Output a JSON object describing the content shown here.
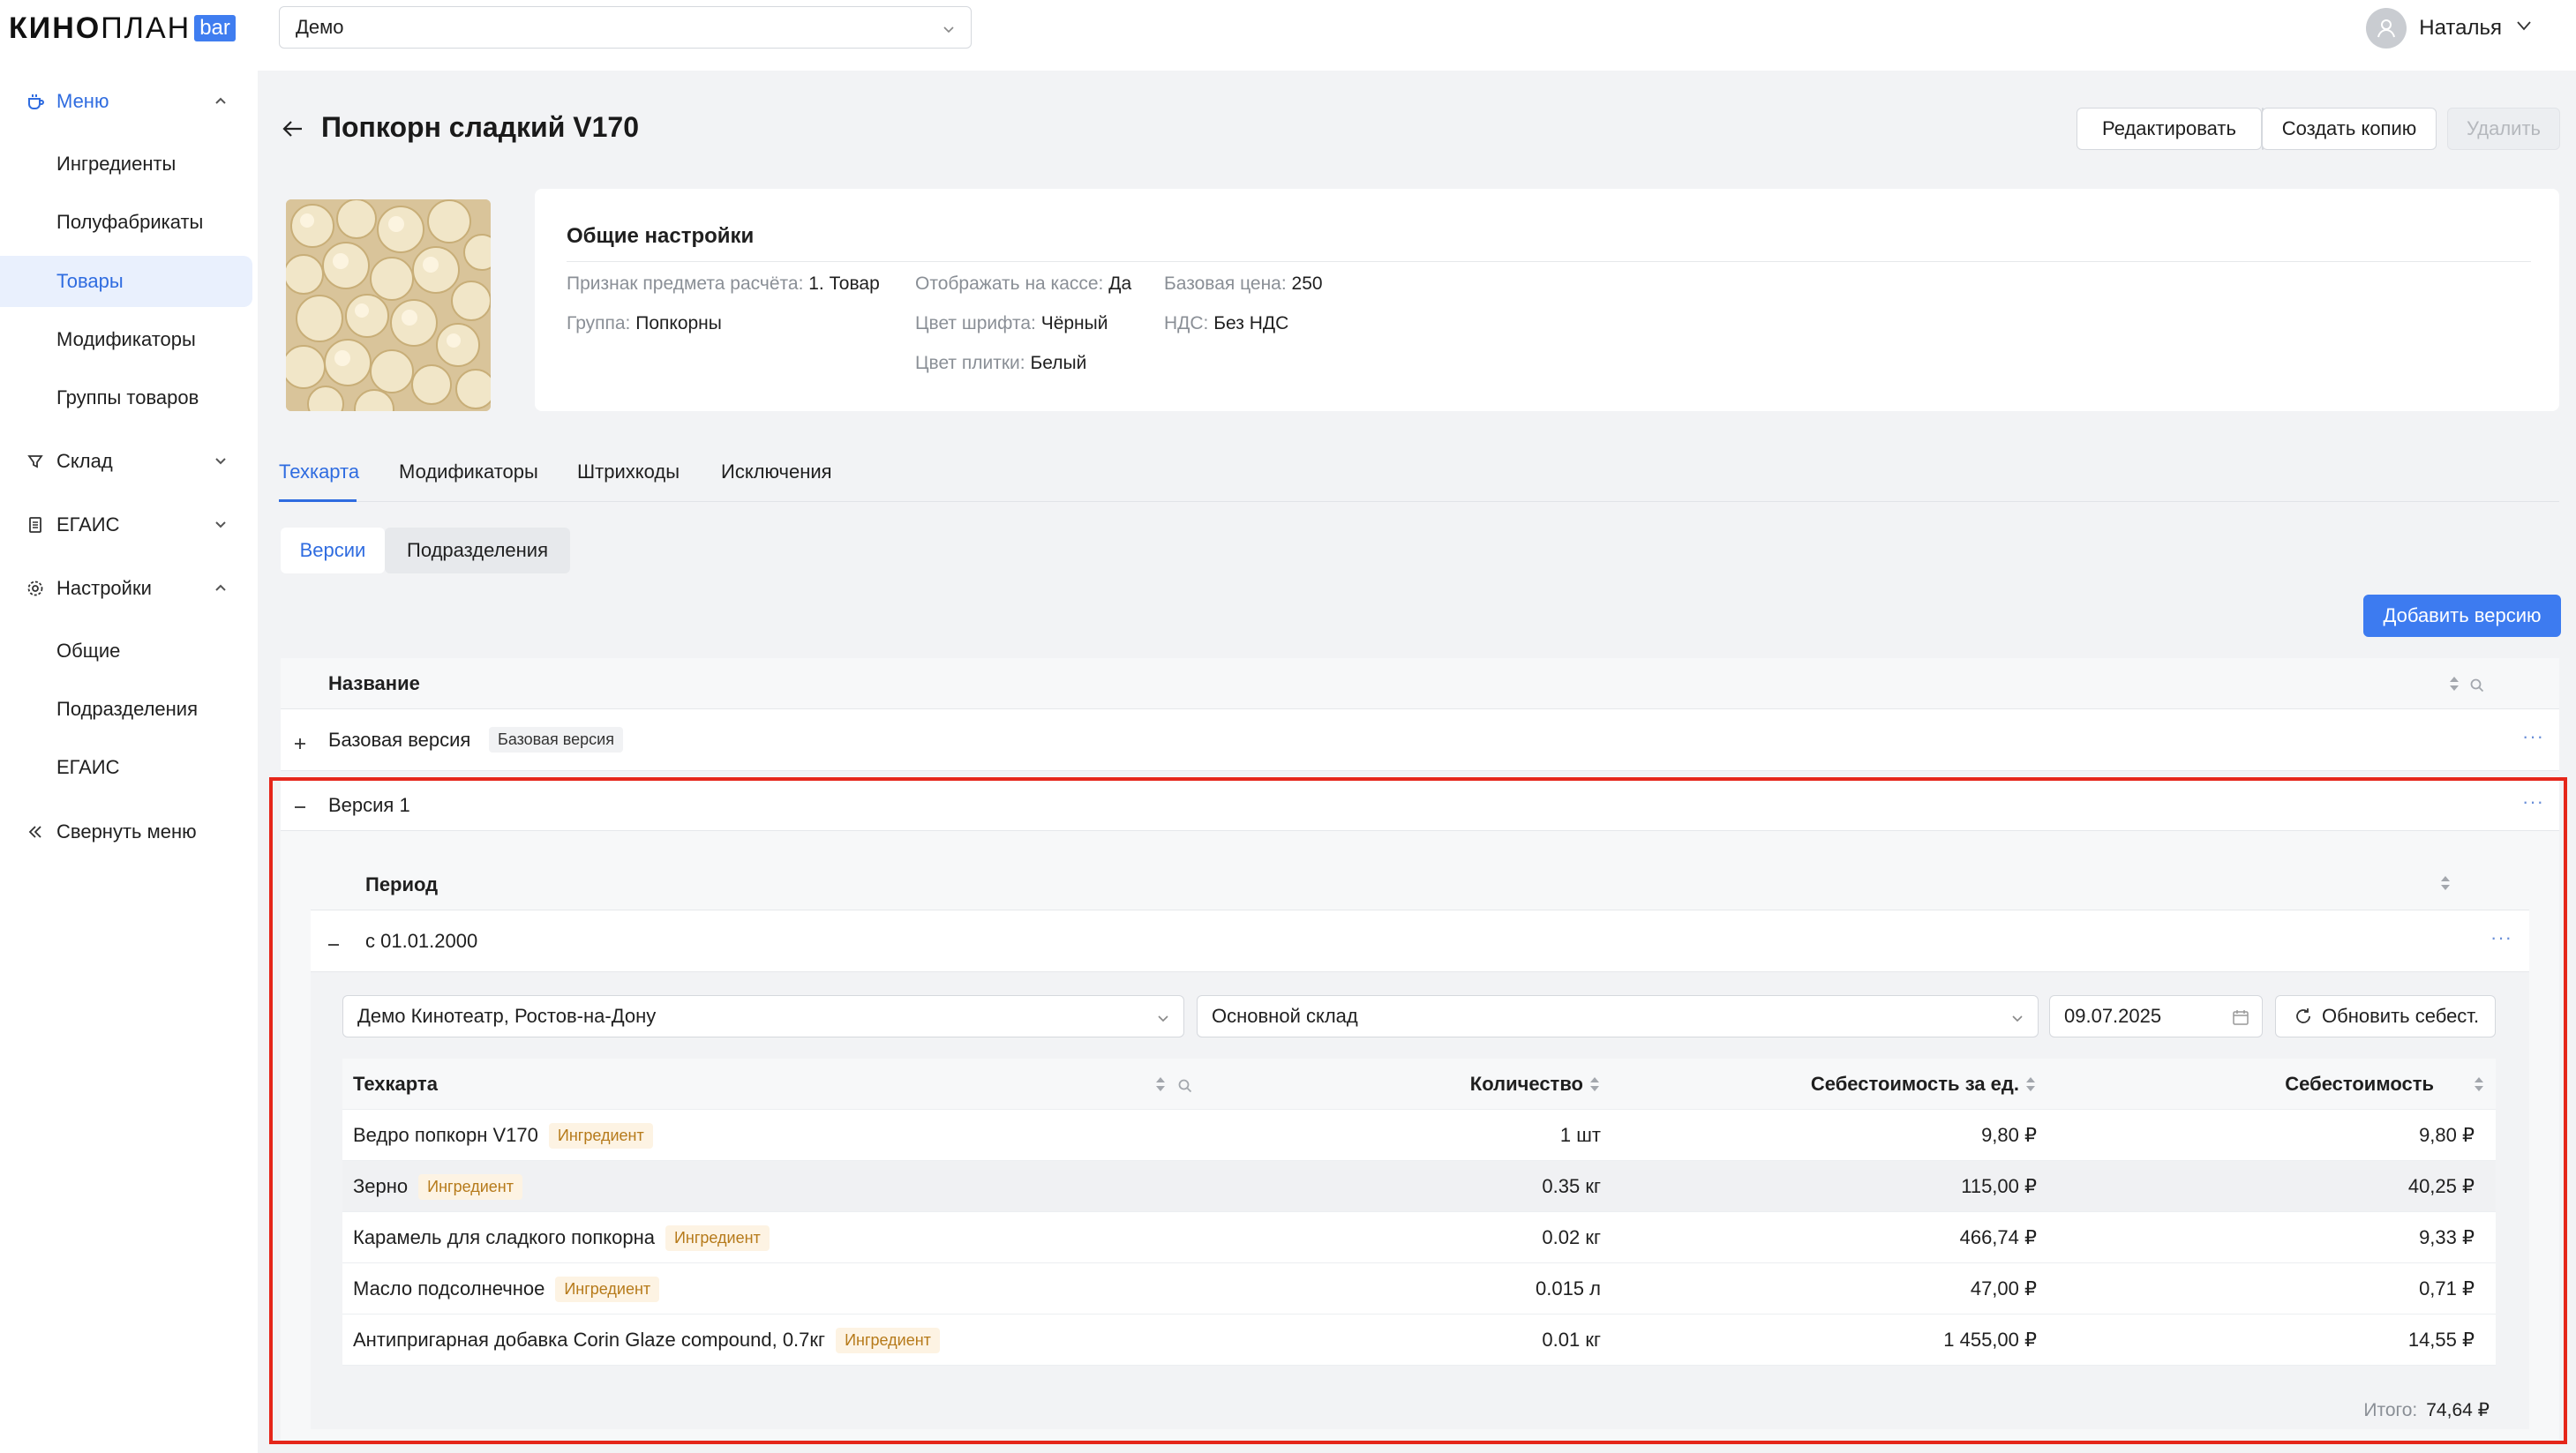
{
  "logo": {
    "kino": "КИНО",
    "plan": "ПЛАН",
    "bar": "bar"
  },
  "sidebar": {
    "menu": {
      "label": "Меню",
      "items": [
        "Ингредиенты",
        "Полуфабрикаты",
        "Товары",
        "Модификаторы",
        "Группы товаров"
      ]
    },
    "warehouse": {
      "label": "Склад"
    },
    "egais": {
      "label": "ЕГАИС"
    },
    "settings": {
      "label": "Настройки",
      "items": [
        "Общие",
        "Подразделения",
        "ЕГАИС"
      ]
    },
    "collapse": {
      "label": "Свернуть меню"
    }
  },
  "topbar": {
    "project": "Демо",
    "user": "Наталья"
  },
  "header": {
    "title": "Попкорн сладкий V170",
    "edit": "Редактировать",
    "copy": "Создать копию",
    "delete": "Удалить"
  },
  "general": {
    "title": "Общие настройки",
    "fields": [
      {
        "k": "Признак предмета расчёта:",
        "v": "1. Товар"
      },
      {
        "k": "Группа:",
        "v": "Попкорны"
      },
      {
        "k": "Отображать на кассе:",
        "v": "Да"
      },
      {
        "k": "Цвет шрифта:",
        "v": "Чёрный"
      },
      {
        "k": "Цвет плитки:",
        "v": "Белый"
      },
      {
        "k": "Базовая цена:",
        "v": "250"
      },
      {
        "k": "НДС:",
        "v": "Без НДС"
      }
    ]
  },
  "tabs": [
    "Техкарта",
    "Модификаторы",
    "Штрихкоды",
    "Исключения"
  ],
  "subtabs": [
    "Версии",
    "Подразделения"
  ],
  "add_version": "Добавить версию",
  "versions_table": {
    "col_name": "Название",
    "rows": [
      {
        "name": "Базовая версия",
        "badge": "Базовая версия"
      },
      {
        "name": "Версия 1"
      }
    ],
    "dots": "···"
  },
  "periods": {
    "col": "Период",
    "row": "с 01.01.2000"
  },
  "filters": {
    "cinema": "Демо Кинотеатр, Ростов-на-Дону",
    "warehouse": "Основной склад",
    "date": "09.07.2025",
    "refresh": "Обновить себест."
  },
  "recipe": {
    "headers": {
      "name": "Техкарта",
      "qty": "Количество",
      "unit_cost": "Себестоимость за ед.",
      "cost": "Себестоимость"
    },
    "rows": [
      {
        "name": "Ведро попкорн V170",
        "tag": "Ингредиент",
        "qty": "1 шт",
        "unit_cost": "9,80 ₽",
        "cost": "9,80 ₽"
      },
      {
        "name": "Зерно",
        "tag": "Ингредиент",
        "qty": "0.35 кг",
        "unit_cost": "115,00 ₽",
        "cost": "40,25 ₽"
      },
      {
        "name": "Карамель для сладкого попкорна",
        "tag": "Ингредиент",
        "qty": "0.02 кг",
        "unit_cost": "466,74 ₽",
        "cost": "9,33 ₽"
      },
      {
        "name": "Масло подсолнечное",
        "tag": "Ингредиент",
        "qty": "0.015 л",
        "unit_cost": "47,00 ₽",
        "cost": "0,71 ₽"
      },
      {
        "name": "Антипригарная добавка Corin Glaze compound, 0.7кг",
        "tag": "Ингредиент",
        "qty": "0.01 кг",
        "unit_cost": "1 455,00 ₽",
        "cost": "14,55 ₽"
      }
    ],
    "total_label": "Итого:",
    "total_value": "74,64 ₽"
  },
  "colors": {
    "accent": "#2f6ce0",
    "highlight_frame": "#e5261a",
    "ingredient_tag": "#b67a1a"
  }
}
